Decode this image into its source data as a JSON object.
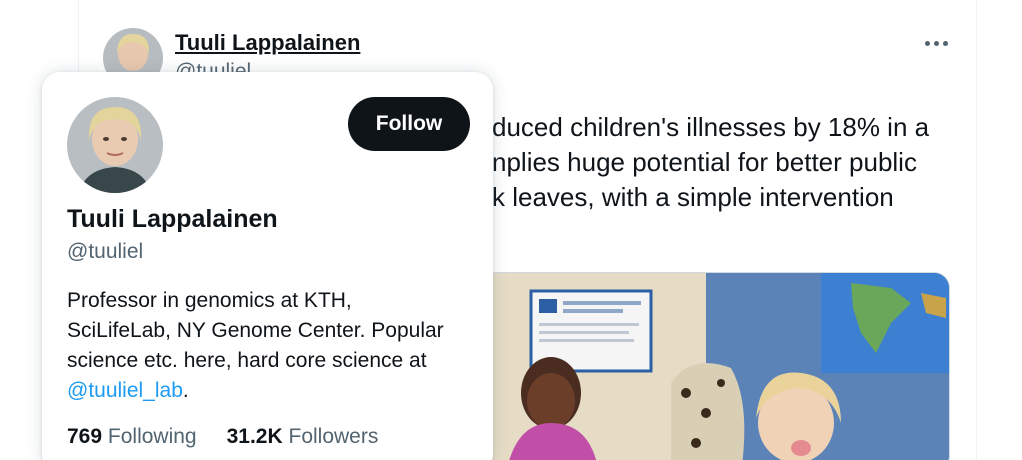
{
  "tweet": {
    "author_name": "Tuuli Lappalainen",
    "author_handle": "@tuuliel",
    "text_lines": [
      "duced children's illnesses by 18% in a",
      "nplies huge potential for better public",
      "k leaves, with a simple intervention"
    ],
    "more_icon": "more-horizontal-icon"
  },
  "hovercard": {
    "name": "Tuuli Lappalainen",
    "handle": "@tuuliel",
    "follow_label": "Follow",
    "bio_lines": [
      "Professor in genomics at KTH,",
      "SciLifeLab, NY Genome Center. Popular",
      "science etc. here, hard core science at"
    ],
    "bio_link": "@tuuliel_lab",
    "bio_suffix": ".",
    "following_count": "769",
    "following_label": "Following",
    "followers_count": "31.2K",
    "followers_label": "Followers"
  },
  "colors": {
    "text": "#0f1419",
    "secondary": "#536471",
    "link": "#1d9bf0",
    "button_bg": "#0f1419"
  }
}
